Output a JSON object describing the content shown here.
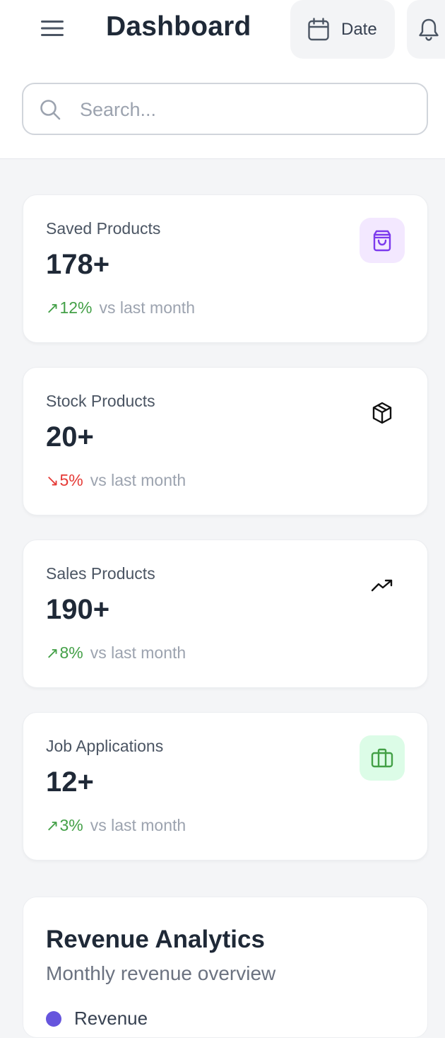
{
  "header": {
    "title": "Dashboard",
    "date_label": "Date",
    "menu_icon": "hamburger-menu-icon",
    "calendar_icon": "calendar-icon",
    "bell_icon": "bell-icon"
  },
  "search": {
    "placeholder": "Search...",
    "value": "",
    "icon": "search-icon"
  },
  "stats": [
    {
      "title": "Saved Products",
      "value": "178+",
      "trend_direction": "up",
      "trend_arrow": "↗",
      "trend_value": "12%",
      "trend_suffix": "vs last month",
      "icon": "shopping-bag-icon",
      "icon_bg": "#f3e8ff",
      "icon_color": "#7c3aed"
    },
    {
      "title": "Stock Products",
      "value": "20+",
      "trend_direction": "down",
      "trend_arrow": "↘",
      "trend_value": "5%",
      "trend_suffix": "vs last month",
      "icon": "package-icon",
      "icon_bg": "#ffffff",
      "icon_color": "#111111"
    },
    {
      "title": "Sales Products",
      "value": "190+",
      "trend_direction": "up",
      "trend_arrow": "↗",
      "trend_value": "8%",
      "trend_suffix": "vs last month",
      "icon": "trending-up-icon",
      "icon_bg": "#ffffff",
      "icon_color": "#111111"
    },
    {
      "title": "Job Applications",
      "value": "12+",
      "trend_direction": "up",
      "trend_arrow": "↗",
      "trend_value": "3%",
      "trend_suffix": "vs last month",
      "icon": "briefcase-icon",
      "icon_bg": "#dcfce7",
      "icon_color": "#43a047"
    }
  ],
  "revenue": {
    "title": "Revenue Analytics",
    "subtitle": "Monthly revenue overview",
    "legend": [
      {
        "label": "Revenue",
        "color": "#6655dd"
      }
    ]
  },
  "colors": {
    "trend_up": "#43a047",
    "trend_down": "#e53935",
    "text_muted": "#9ca3af"
  }
}
